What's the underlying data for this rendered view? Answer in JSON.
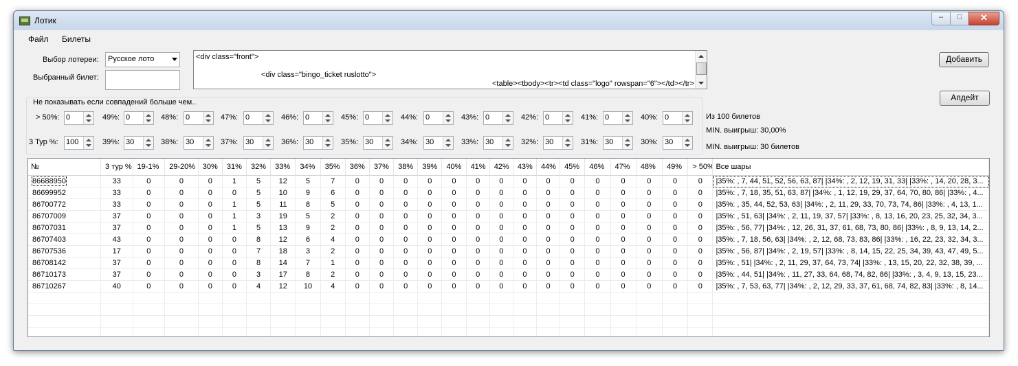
{
  "window": {
    "title": "Лотик"
  },
  "menu": {
    "file": "Файл",
    "tickets": "Билеты"
  },
  "form": {
    "lottery_label": "Выбор лотереи:",
    "lottery_value": "Русское лото",
    "ticket_label": "Выбранный билет:",
    "ticket_value": "",
    "html_lines": [
      "<div class=\"front\">",
      "<div class=\"bingo_ticket ruslotto\">",
      "<table><tbody><tr><td class=\"logo\" rowspan=\"6\"></td></tr>"
    ]
  },
  "buttons": {
    "add": "Добавить",
    "update": "Апдейт"
  },
  "filters": {
    "group_title": "Не показывать если совпадений больше чем..",
    "row1": [
      {
        "label": "> 50%:",
        "value": "0"
      },
      {
        "label": "49%:",
        "value": "0"
      },
      {
        "label": "48%:",
        "value": "0"
      },
      {
        "label": "47%:",
        "value": "0"
      },
      {
        "label": "46%:",
        "value": "0"
      },
      {
        "label": "45%:",
        "value": "0"
      },
      {
        "label": "44%:",
        "value": "0"
      },
      {
        "label": "43%:",
        "value": "0"
      },
      {
        "label": "42%:",
        "value": "0"
      },
      {
        "label": "41%:",
        "value": "0"
      },
      {
        "label": "40%:",
        "value": "0"
      }
    ],
    "row2": [
      {
        "label": "3 Тур %:",
        "value": "100"
      },
      {
        "label": "39%:",
        "value": "30"
      },
      {
        "label": "38%:",
        "value": "30"
      },
      {
        "label": "37%:",
        "value": "30"
      },
      {
        "label": "36%:",
        "value": "30"
      },
      {
        "label": "35%:",
        "value": "30"
      },
      {
        "label": "34%:",
        "value": "30"
      },
      {
        "label": "33%:",
        "value": "30"
      },
      {
        "label": "32%:",
        "value": "30"
      },
      {
        "label": "31%:",
        "value": "30"
      },
      {
        "label": "30%:",
        "value": "30"
      }
    ]
  },
  "stats": {
    "total": "Из 100 билетов",
    "min_win": "MIN. выигрыш: 30,00%",
    "min_win_tickets": "MIN. выигрыш: 30 билетов"
  },
  "table": {
    "columns": [
      "№",
      "3 тур %",
      "19-1%",
      "29-20%",
      "30%",
      "31%",
      "32%",
      "33%",
      "34%",
      "35%",
      "36%",
      "37%",
      "38%",
      "39%",
      "40%",
      "41%",
      "42%",
      "43%",
      "44%",
      "45%",
      "46%",
      "47%",
      "48%",
      "49%",
      "> 50%",
      "Все шары"
    ],
    "rows": [
      [
        "86688950",
        "33",
        "0",
        "0",
        "0",
        "1",
        "5",
        "12",
        "5",
        "7",
        "0",
        "0",
        "0",
        "0",
        "0",
        "0",
        "0",
        "0",
        "0",
        "0",
        "0",
        "0",
        "0",
        "0",
        "0",
        "|35%: , 7, 44, 51, 52, 56, 63, 87| |34%: , 2, 12, 19, 31, 33| |33%: , 14, 20, 28, 3..."
      ],
      [
        "86699952",
        "33",
        "0",
        "0",
        "0",
        "0",
        "5",
        "10",
        "9",
        "6",
        "0",
        "0",
        "0",
        "0",
        "0",
        "0",
        "0",
        "0",
        "0",
        "0",
        "0",
        "0",
        "0",
        "0",
        "0",
        "|35%: , 7, 18, 35, 51, 63, 87| |34%: , 1, 12, 19, 29, 37, 64, 70, 80, 86| |33%: , 4..."
      ],
      [
        "86700772",
        "33",
        "0",
        "0",
        "0",
        "1",
        "5",
        "11",
        "8",
        "5",
        "0",
        "0",
        "0",
        "0",
        "0",
        "0",
        "0",
        "0",
        "0",
        "0",
        "0",
        "0",
        "0",
        "0",
        "0",
        "|35%: , 35, 44, 52, 53, 63| |34%: , 2, 11, 29, 33, 70, 73, 74, 86| |33%: , 4, 13, 1..."
      ],
      [
        "86707009",
        "37",
        "0",
        "0",
        "0",
        "1",
        "3",
        "19",
        "5",
        "2",
        "0",
        "0",
        "0",
        "0",
        "0",
        "0",
        "0",
        "0",
        "0",
        "0",
        "0",
        "0",
        "0",
        "0",
        "0",
        "|35%: , 51, 63| |34%: , 2, 11, 19, 37, 57| |33%: , 8, 13, 16, 20, 23, 25, 32, 34, 3..."
      ],
      [
        "86707031",
        "37",
        "0",
        "0",
        "0",
        "1",
        "5",
        "13",
        "9",
        "2",
        "0",
        "0",
        "0",
        "0",
        "0",
        "0",
        "0",
        "0",
        "0",
        "0",
        "0",
        "0",
        "0",
        "0",
        "0",
        "|35%: , 56, 77| |34%: , 12, 26, 31, 37, 61, 68, 73, 80, 86| |33%: , 8, 9, 13, 14, 2..."
      ],
      [
        "86707403",
        "43",
        "0",
        "0",
        "0",
        "0",
        "8",
        "12",
        "6",
        "4",
        "0",
        "0",
        "0",
        "0",
        "0",
        "0",
        "0",
        "0",
        "0",
        "0",
        "0",
        "0",
        "0",
        "0",
        "0",
        "|35%: , 7, 18, 56, 63| |34%: , 2, 12, 68, 73, 83, 86| |33%: , 16, 22, 23, 32, 34, 3..."
      ],
      [
        "86707536",
        "17",
        "0",
        "0",
        "0",
        "0",
        "7",
        "18",
        "3",
        "2",
        "0",
        "0",
        "0",
        "0",
        "0",
        "0",
        "0",
        "0",
        "0",
        "0",
        "0",
        "0",
        "0",
        "0",
        "0",
        "|35%: , 56, 87| |34%: , 2, 19, 57| |33%: , 8, 14, 15, 22, 25, 34, 39, 43, 47, 49, 5..."
      ],
      [
        "86708142",
        "37",
        "0",
        "0",
        "0",
        "0",
        "8",
        "14",
        "7",
        "1",
        "0",
        "0",
        "0",
        "0",
        "0",
        "0",
        "0",
        "0",
        "0",
        "0",
        "0",
        "0",
        "0",
        "0",
        "0",
        "|35%: , 51| |34%: , 2, 11, 29, 37, 64, 73, 74| |33%: , 13, 15, 20, 22, 32, 38, 39, ..."
      ],
      [
        "86710173",
        "37",
        "0",
        "0",
        "0",
        "0",
        "3",
        "17",
        "8",
        "2",
        "0",
        "0",
        "0",
        "0",
        "0",
        "0",
        "0",
        "0",
        "0",
        "0",
        "0",
        "0",
        "0",
        "0",
        "0",
        "|35%: , 44, 51| |34%: , 11, 27, 33, 64, 68, 74, 82, 86| |33%: , 3, 4, 9, 13, 15, 23..."
      ],
      [
        "86710267",
        "40",
        "0",
        "0",
        "0",
        "0",
        "4",
        "12",
        "10",
        "4",
        "0",
        "0",
        "0",
        "0",
        "0",
        "0",
        "0",
        "0",
        "0",
        "0",
        "0",
        "0",
        "0",
        "0",
        "0",
        "|35%: , 7, 53, 63, 77| |34%: , 2, 12, 29, 33, 37, 61, 68, 74, 82, 83| |33%: , 8, 14..."
      ]
    ]
  }
}
